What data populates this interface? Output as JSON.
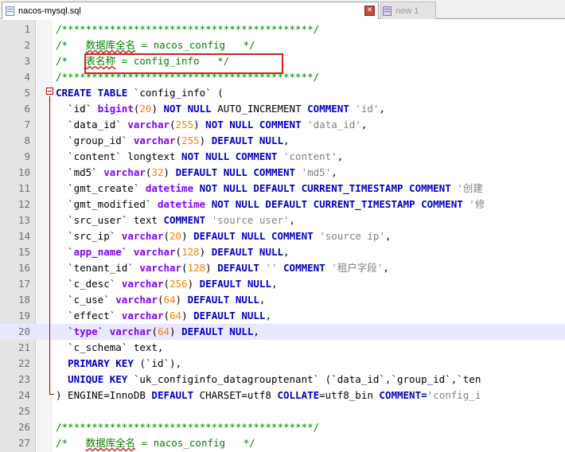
{
  "tabs": {
    "active": {
      "label": "nacos-mysql.sql",
      "icon": "sql-file-icon"
    },
    "inactive": {
      "label": "new 1",
      "icon": "new-file-icon"
    },
    "close_symbol": "✕"
  },
  "editor": {
    "current_line": 20,
    "highlighted_box_line": 2,
    "lines": [
      {
        "num": "1",
        "segs": [
          [
            "c",
            "/******************************************/"
          ]
        ]
      },
      {
        "num": "2",
        "segs": [
          [
            "c",
            "/*   "
          ],
          [
            "cz",
            "数据库全名"
          ],
          [
            "c",
            " = nacos_config   */"
          ]
        ]
      },
      {
        "num": "3",
        "segs": [
          [
            "c",
            "/*   "
          ],
          [
            "cz",
            "表名称"
          ],
          [
            "c",
            " = config_info   */"
          ]
        ]
      },
      {
        "num": "4",
        "segs": [
          [
            "c",
            "/******************************************/"
          ]
        ]
      },
      {
        "num": "5",
        "segs": [
          [
            "k",
            "CREATE TABLE"
          ],
          [
            "p",
            " `config_info` ("
          ]
        ]
      },
      {
        "num": "6",
        "segs": [
          [
            "p",
            "  `id` "
          ],
          [
            "t",
            "bigint"
          ],
          [
            "p",
            "("
          ],
          [
            "n",
            "20"
          ],
          [
            "p",
            ") "
          ],
          [
            "k",
            "NOT NULL"
          ],
          [
            "p",
            " AUTO_INCREMENT "
          ],
          [
            "k",
            "COMMENT"
          ],
          [
            "p",
            " "
          ],
          [
            "s",
            "'id'"
          ],
          [
            "p",
            ","
          ]
        ]
      },
      {
        "num": "7",
        "segs": [
          [
            "p",
            "  `data_id` "
          ],
          [
            "t",
            "varchar"
          ],
          [
            "p",
            "("
          ],
          [
            "n",
            "255"
          ],
          [
            "p",
            ") "
          ],
          [
            "k",
            "NOT NULL COMMENT"
          ],
          [
            "p",
            " "
          ],
          [
            "s",
            "'data_id'"
          ],
          [
            "p",
            ","
          ]
        ]
      },
      {
        "num": "8",
        "segs": [
          [
            "p",
            "  `group_id` "
          ],
          [
            "t",
            "varchar"
          ],
          [
            "p",
            "("
          ],
          [
            "n",
            "255"
          ],
          [
            "p",
            ") "
          ],
          [
            "k",
            "DEFAULT NULL"
          ],
          [
            "p",
            ","
          ]
        ]
      },
      {
        "num": "9",
        "segs": [
          [
            "p",
            "  `content` longtext "
          ],
          [
            "k",
            "NOT NULL COMMENT"
          ],
          [
            "p",
            " "
          ],
          [
            "s",
            "'content'"
          ],
          [
            "p",
            ","
          ]
        ]
      },
      {
        "num": "10",
        "segs": [
          [
            "p",
            "  `md5` "
          ],
          [
            "t",
            "varchar"
          ],
          [
            "p",
            "("
          ],
          [
            "n",
            "32"
          ],
          [
            "p",
            ") "
          ],
          [
            "k",
            "DEFAULT NULL COMMENT"
          ],
          [
            "p",
            " "
          ],
          [
            "s",
            "'md5'"
          ],
          [
            "p",
            ","
          ]
        ]
      },
      {
        "num": "11",
        "segs": [
          [
            "p",
            "  `gmt_create` "
          ],
          [
            "t",
            "datetime"
          ],
          [
            "p",
            " "
          ],
          [
            "k",
            "NOT NULL DEFAULT CURRENT_TIMESTAMP COMMENT"
          ],
          [
            "p",
            " "
          ],
          [
            "s",
            "'创建"
          ]
        ]
      },
      {
        "num": "12",
        "segs": [
          [
            "p",
            "  `gmt_modified` "
          ],
          [
            "t",
            "datetime"
          ],
          [
            "p",
            " "
          ],
          [
            "k",
            "NOT NULL DEFAULT CURRENT_TIMESTAMP COMMENT"
          ],
          [
            "p",
            " "
          ],
          [
            "s",
            "'修"
          ]
        ]
      },
      {
        "num": "13",
        "segs": [
          [
            "p",
            "  `src_user` text "
          ],
          [
            "k",
            "COMMENT"
          ],
          [
            "p",
            " "
          ],
          [
            "s",
            "'source user'"
          ],
          [
            "p",
            ","
          ]
        ]
      },
      {
        "num": "14",
        "segs": [
          [
            "p",
            "  `src_ip` "
          ],
          [
            "t",
            "varchar"
          ],
          [
            "p",
            "("
          ],
          [
            "n",
            "20"
          ],
          [
            "p",
            ") "
          ],
          [
            "k",
            "DEFAULT NULL COMMENT"
          ],
          [
            "p",
            " "
          ],
          [
            "s",
            "'source ip'"
          ],
          [
            "p",
            ","
          ]
        ]
      },
      {
        "num": "15",
        "segs": [
          [
            "p",
            "  "
          ],
          [
            "t",
            "`app_name`"
          ],
          [
            "p",
            " "
          ],
          [
            "t",
            "varchar"
          ],
          [
            "p",
            "("
          ],
          [
            "n",
            "128"
          ],
          [
            "p",
            ") "
          ],
          [
            "k",
            "DEFAULT NULL"
          ],
          [
            "p",
            ","
          ]
        ]
      },
      {
        "num": "16",
        "segs": [
          [
            "p",
            "  `tenant_id` "
          ],
          [
            "t",
            "varchar"
          ],
          [
            "p",
            "("
          ],
          [
            "n",
            "128"
          ],
          [
            "p",
            ") "
          ],
          [
            "k",
            "DEFAULT"
          ],
          [
            "p",
            " "
          ],
          [
            "s",
            "''"
          ],
          [
            "p",
            " "
          ],
          [
            "k",
            "COMMENT"
          ],
          [
            "p",
            " "
          ],
          [
            "s",
            "'租户字段'"
          ],
          [
            "p",
            ","
          ]
        ]
      },
      {
        "num": "17",
        "segs": [
          [
            "p",
            "  `c_desc` "
          ],
          [
            "t",
            "varchar"
          ],
          [
            "p",
            "("
          ],
          [
            "n",
            "256"
          ],
          [
            "p",
            ") "
          ],
          [
            "k",
            "DEFAULT NULL"
          ],
          [
            "p",
            ","
          ]
        ]
      },
      {
        "num": "18",
        "segs": [
          [
            "p",
            "  `c_use` "
          ],
          [
            "t",
            "varchar"
          ],
          [
            "p",
            "("
          ],
          [
            "n",
            "64"
          ],
          [
            "p",
            ") "
          ],
          [
            "k",
            "DEFAULT NULL"
          ],
          [
            "p",
            ","
          ]
        ]
      },
      {
        "num": "19",
        "segs": [
          [
            "p",
            "  `effect` "
          ],
          [
            "t",
            "varchar"
          ],
          [
            "p",
            "("
          ],
          [
            "n",
            "64"
          ],
          [
            "p",
            ") "
          ],
          [
            "k",
            "DEFAULT NULL"
          ],
          [
            "p",
            ","
          ]
        ]
      },
      {
        "num": "20",
        "segs": [
          [
            "p",
            "  "
          ],
          [
            "t",
            "`type`"
          ],
          [
            "p",
            " "
          ],
          [
            "t",
            "varchar"
          ],
          [
            "p",
            "("
          ],
          [
            "n",
            "64"
          ],
          [
            "p",
            ") "
          ],
          [
            "k",
            "DEFAULT NULL"
          ],
          [
            "p",
            ","
          ]
        ]
      },
      {
        "num": "21",
        "segs": [
          [
            "p",
            "  `c_schema` text,"
          ]
        ]
      },
      {
        "num": "22",
        "segs": [
          [
            "p",
            "  "
          ],
          [
            "k",
            "PRIMARY KEY"
          ],
          [
            "p",
            " (`id`),"
          ]
        ]
      },
      {
        "num": "23",
        "segs": [
          [
            "p",
            "  "
          ],
          [
            "k",
            "UNIQUE KEY"
          ],
          [
            "p",
            " `uk_configinfo_datagrouptenant` (`data_id`,`group_id`,`ten"
          ]
        ]
      },
      {
        "num": "24",
        "segs": [
          [
            "p",
            ") ENGINE=InnoDB "
          ],
          [
            "k",
            "DEFAULT"
          ],
          [
            "p",
            " CHARSET=utf8 "
          ],
          [
            "k",
            "COLLATE"
          ],
          [
            "p",
            "=utf8_bin "
          ],
          [
            "k",
            "COMMENT"
          ],
          [
            "o",
            "="
          ],
          [
            "s",
            "'config_i"
          ]
        ]
      },
      {
        "num": "25",
        "segs": []
      },
      {
        "num": "26",
        "segs": [
          [
            "c",
            "/******************************************/"
          ]
        ]
      },
      {
        "num": "27",
        "segs": [
          [
            "c",
            "/*   "
          ],
          [
            "cz",
            "数据库全名"
          ],
          [
            "c",
            " = nacos_config   */"
          ]
        ]
      }
    ]
  }
}
